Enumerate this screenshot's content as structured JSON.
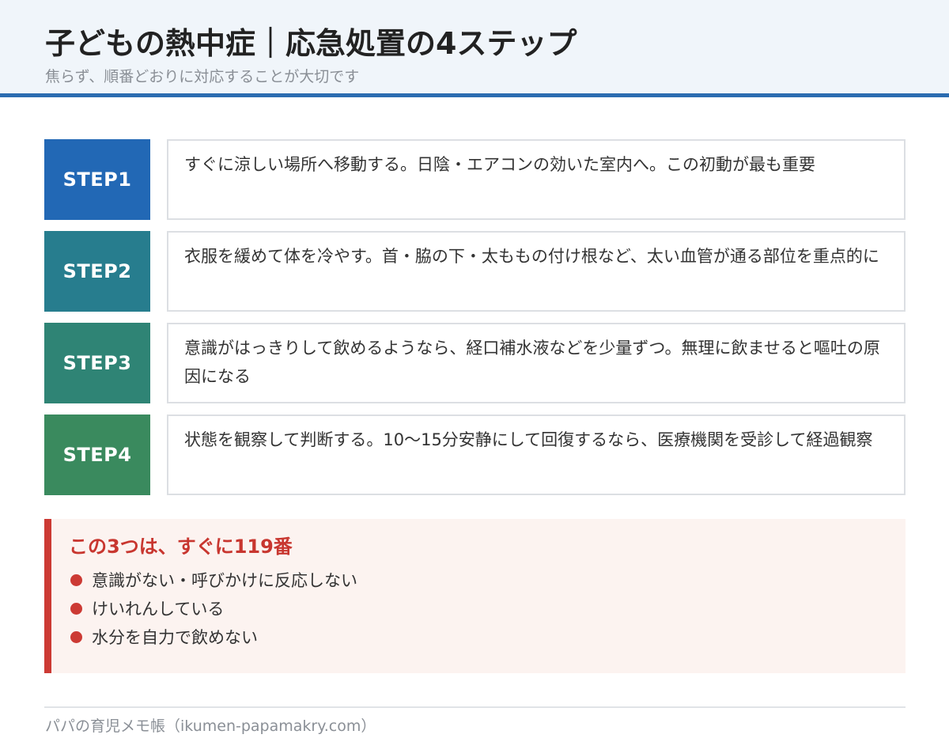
{
  "header": {
    "title": "子どもの熱中症｜応急処置の4ステップ",
    "subtitle": "焦らず、順番どおりに対応することが大切です"
  },
  "steps": [
    {
      "label": "STEP1",
      "text": "すぐに涼しい場所へ移動する。日陰・エアコンの効いた室内へ。この初動が最も重要",
      "color": "#2268b5"
    },
    {
      "label": "STEP2",
      "text": "衣服を緩めて体を冷やす。首・脇の下・太ももの付け根など、太い血管が通る部位を重点的に",
      "color": "#277d8e"
    },
    {
      "label": "STEP3",
      "text": "意識がはっきりして飲めるようなら、経口補水液などを少量ずつ。無理に飲ませると嘔吐の原因になる",
      "color": "#2f8475"
    },
    {
      "label": "STEP4",
      "text": "状態を観察して判断する。10〜15分安静にして回復するなら、医療機関を受診して経過観察",
      "color": "#3a8a5e"
    }
  ],
  "alert": {
    "title": "この3つは、すぐに119番",
    "items": [
      "意識がない・呼びかけに反応しない",
      "けいれんしている",
      "水分を自力で飲めない"
    ],
    "accent_color": "#cc3a34",
    "background_color": "#fcf3f0"
  },
  "footer": {
    "credit": "パパの育児メモ帳（ikumen-papamakry.com）"
  }
}
